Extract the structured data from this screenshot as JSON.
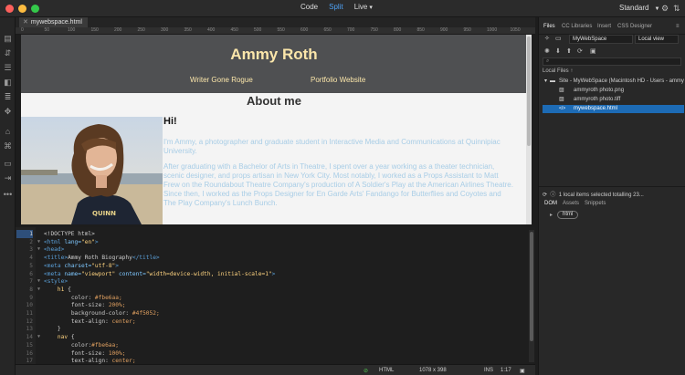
{
  "window": {
    "modes": {
      "code": "Code",
      "split": "Split",
      "live": "Live"
    },
    "workspace": "Standard"
  },
  "document": {
    "tab_label": "mywebspace.html",
    "ruler_ticks": [
      "0",
      "50",
      "100",
      "150",
      "200",
      "250",
      "300",
      "350",
      "400",
      "450",
      "500",
      "550",
      "600",
      "650",
      "700",
      "750",
      "800",
      "850",
      "900",
      "950",
      "1000",
      "1050"
    ]
  },
  "live_view": {
    "title": "Ammy Roth",
    "nav": [
      "Writer Gone Rogue",
      "Portfolio Website"
    ],
    "heading": "About me",
    "greeting": "Hi!",
    "paragraph1": "I'm Ammy, a photographer and graduate student in Interactive Media and Communications at Quinnipiac University.",
    "paragraph2": "After graduating with a Bachelor of Arts in Theatre, I spent over a year working as a theater technician, scenic designer, and props artisan in New York City. Most notably, I worked as a Props Assistant to Matt Frew on the Roundabout Theatre Company's production of A Soldier's Play at the American Airlines Theatre. Since then, I worked as the Props Designer for En Garde Arts' Fandango for Butterflies and Coyotes and The Play Company's Lunch Bunch.",
    "colors": {
      "header_bg": "#4f5052",
      "header_text": "#fbe6aa",
      "body_text": "#a8cde6"
    }
  },
  "code_view": {
    "lines": [
      {
        "n": "1",
        "fold": "",
        "html": "<span class=\"c-plain\">&lt;!DOCTYPE html&gt;</span>"
      },
      {
        "n": "2",
        "fold": "▼",
        "html": "<span class=\"c-tag\">&lt;html</span> <span class=\"c-attr\">lang=</span><span class=\"c-str\">\"en\"</span><span class=\"c-tag\">&gt;</span>"
      },
      {
        "n": "3",
        "fold": "▼",
        "html": "<span class=\"c-tag\">&lt;head&gt;</span>"
      },
      {
        "n": "4",
        "fold": "",
        "html": "<span class=\"c-tag\">&lt;title&gt;</span><span class=\"c-plain\">Ammy Roth Biography</span><span class=\"c-tag\">&lt;/title&gt;</span>"
      },
      {
        "n": "5",
        "fold": "",
        "html": "<span class=\"c-tag\">&lt;meta</span> <span class=\"c-attr\">charset=</span><span class=\"c-str\">\"utf-8\"</span><span class=\"c-tag\">&gt;</span>"
      },
      {
        "n": "6",
        "fold": "",
        "html": "<span class=\"c-tag\">&lt;meta</span> <span class=\"c-attr\">name=</span><span class=\"c-str\">\"viewport\"</span> <span class=\"c-attr\">content=</span><span class=\"c-str\">\"width=device-width, initial-scale=1\"</span><span class=\"c-tag\">&gt;</span>"
      },
      {
        "n": "7",
        "fold": "▼",
        "html": "<span class=\"c-tag\">&lt;style&gt;</span>"
      },
      {
        "n": "8",
        "fold": "▼",
        "html": "    <span class=\"c-sel\">h1</span> <span class=\"c-plain\">{</span>"
      },
      {
        "n": "9",
        "fold": "",
        "html": "        <span class=\"c-prop\">color:</span> <span class=\"c-val\">#fbe6aa;</span>"
      },
      {
        "n": "10",
        "fold": "",
        "html": "        <span class=\"c-prop\">font-size:</span> <span class=\"c-val\">200%;</span>"
      },
      {
        "n": "11",
        "fold": "",
        "html": "        <span class=\"c-prop\">background-color:</span> <span class=\"c-val\">#4f5052;</span>"
      },
      {
        "n": "12",
        "fold": "",
        "html": "        <span class=\"c-prop\">text-align:</span> <span class=\"c-val\">center;</span>"
      },
      {
        "n": "13",
        "fold": "",
        "html": "    <span class=\"c-plain\">}</span>"
      },
      {
        "n": "14",
        "fold": "▼",
        "html": "    <span class=\"c-sel\">nav</span> <span class=\"c-plain\">{</span>"
      },
      {
        "n": "15",
        "fold": "",
        "html": "        <span class=\"c-prop\">color:</span><span class=\"c-val\">#fbe6aa;</span>"
      },
      {
        "n": "16",
        "fold": "",
        "html": "        <span class=\"c-prop\">font-size:</span> <span class=\"c-val\">100%;</span>"
      },
      {
        "n": "17",
        "fold": "",
        "html": "        <span class=\"c-prop\">text-align:</span> <span class=\"c-val\">center;</span>"
      }
    ]
  },
  "status_bar": {
    "language": "HTML",
    "size": "1078 x 398",
    "mode": "INS",
    "position": "1:17"
  },
  "files_panel": {
    "tabs": [
      "Files",
      "CC Libraries",
      "Insert",
      "CSS Designer"
    ],
    "site_select": "MyWebSpace",
    "view_select": "Local view",
    "local_files_label": "Local Files",
    "tree": [
      {
        "label": "Site - MyWebSpace (Macintosh HD - Users - ammy - Data -...",
        "kind": "site",
        "selected": false
      },
      {
        "label": "ammyroth photo.png",
        "kind": "image",
        "selected": false
      },
      {
        "label": "ammyroth photo.tiff",
        "kind": "image",
        "selected": false
      },
      {
        "label": "mywebspace.html",
        "kind": "code",
        "selected": true
      }
    ],
    "status": "1 local items selected totalling 23...",
    "bottom_tabs": [
      "DOM",
      "Assets",
      "Snippets"
    ],
    "dom_root": "html"
  }
}
